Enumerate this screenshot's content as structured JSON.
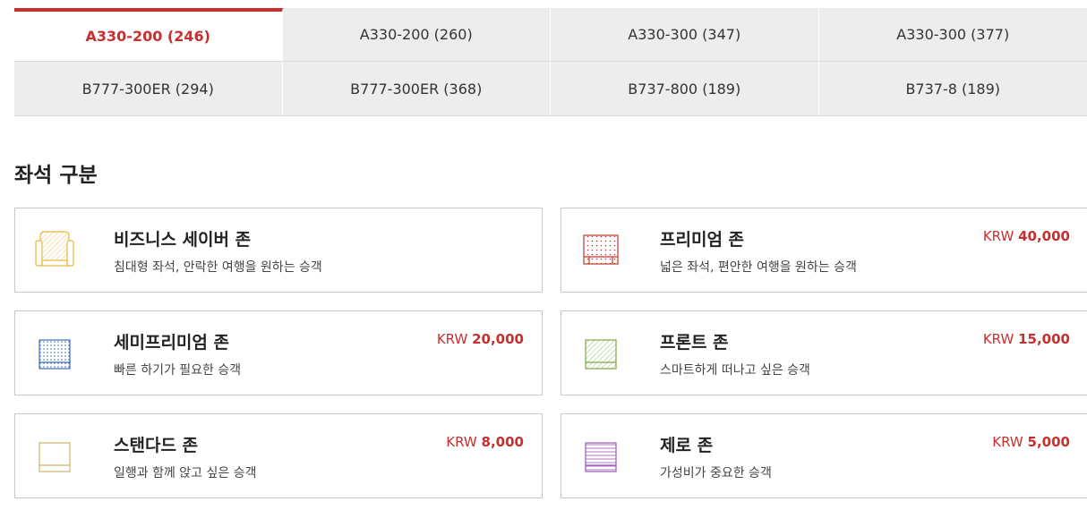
{
  "tabs": [
    {
      "label": "A330-200 (246)",
      "active": true
    },
    {
      "label": "A330-200 (260)",
      "active": false
    },
    {
      "label": "A330-300 (347)",
      "active": false
    },
    {
      "label": "A330-300 (377)",
      "active": false
    },
    {
      "label": "B777-300ER (294)",
      "active": false
    },
    {
      "label": "B777-300ER (368)",
      "active": false
    },
    {
      "label": "B737-800 (189)",
      "active": false
    },
    {
      "label": "B737-8 (189)",
      "active": false
    }
  ],
  "section_title": "좌석 구분",
  "zones": [
    {
      "name": "비즈니스 세이버 존",
      "desc": "침대형 좌석, 안락한 여행을 원하는 승객",
      "currency": "",
      "price": "",
      "icon": "business-saver-seat-icon",
      "color": "#e8b63a"
    },
    {
      "name": "프리미엄 존",
      "desc": "넓은 좌석, 편안한 여행을 원하는 승객",
      "currency": "KRW",
      "price": "40,000",
      "icon": "premium-seat-icon",
      "color": "#c0392b"
    },
    {
      "name": "세미프리미엄 존",
      "desc": "빠른 하기가 필요한 승객",
      "currency": "KRW",
      "price": "20,000",
      "icon": "semi-premium-seat-icon",
      "color": "#3d6bbf"
    },
    {
      "name": "프론트 존",
      "desc": "스마트하게 떠나고 싶은 승객",
      "currency": "KRW",
      "price": "15,000",
      "icon": "front-seat-icon",
      "color": "#7ea64a"
    },
    {
      "name": "스탠다드 존",
      "desc": "일행과 함께 앉고 싶은 승객",
      "currency": "KRW",
      "price": "8,000",
      "icon": "standard-seat-icon",
      "color": "#cbb56a"
    },
    {
      "name": "제로 존",
      "desc": "가성비가 중요한 승객",
      "currency": "KRW",
      "price": "5,000",
      "icon": "zero-seat-icon",
      "color": "#9b59b6"
    }
  ]
}
